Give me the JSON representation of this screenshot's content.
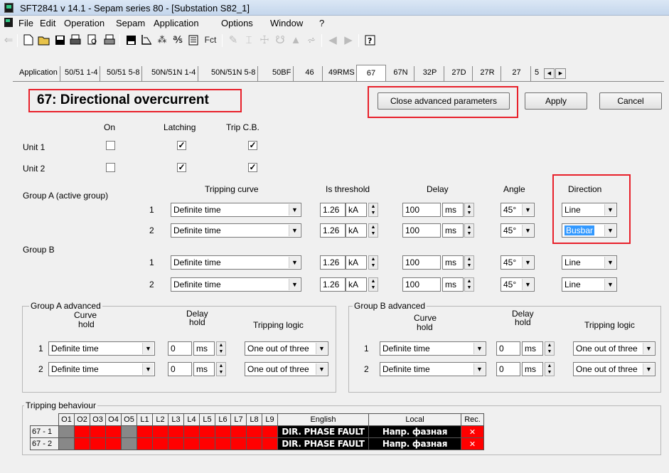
{
  "title_bar": {
    "title": "SFT2841  v 14.1 - Sepam series 80 - [Substation S82_1]"
  },
  "menu": [
    "File",
    "Edit",
    "Operation",
    "Sepam",
    "Application",
    "Options",
    "Window",
    "?"
  ],
  "toolbar": {
    "fct_label": "Fct",
    "icons": [
      "back-icon",
      "new-file-icon",
      "open-folder-icon",
      "save-icon",
      "print-icon",
      "print-preview-icon",
      "printer-setup-icon",
      "floppy-icon",
      "chart-icon",
      "connection-icon",
      "network-icon",
      "settings-icon",
      "fct-icon",
      "pen-icon",
      "tool-a-icon",
      "tool-b-icon",
      "tool-c-icon",
      "tool-d-icon",
      "tool-e-icon",
      "arrow-left-icon",
      "arrow-right-icon",
      "help-icon"
    ]
  },
  "tabs": [
    "Application",
    "50/51 1-4",
    "50/51 5-8",
    "50N/51N 1-4",
    "50N/51N 5-8",
    "50BF",
    "46",
    "49RMS",
    "67",
    "67N",
    "32P",
    "27D",
    "27R",
    "27"
  ],
  "tab_scroll": "5",
  "selected_tab": "67",
  "panel": {
    "heading": "67: Directional overcurrent",
    "close_adv_button": "Close advanced parameters",
    "apply_button": "Apply",
    "cancel_button": "Cancel",
    "col_on": "On",
    "col_latching": "Latching",
    "col_trip": "Trip C.B.",
    "unit1": {
      "label": "Unit 1",
      "on": false,
      "latching": true,
      "trip": true
    },
    "unit2": {
      "label": "Unit 2",
      "on": false,
      "latching": true,
      "trip": true
    },
    "headers": {
      "curve": "Tripping curve",
      "threshold": "Is threshold",
      "delay": "Delay",
      "angle": "Angle",
      "direction": "Direction"
    },
    "group_a_label": "Group A  (active group)",
    "group_b_label": "Group B",
    "rows": [
      {
        "n": "1",
        "curve": "Definite time",
        "is": "1.26",
        "is_unit": "kA",
        "delay": "100",
        "delay_unit": "ms",
        "angle": "45°",
        "direction": "Line"
      },
      {
        "n": "2",
        "curve": "Definite time",
        "is": "1.26",
        "is_unit": "kA",
        "delay": "100",
        "delay_unit": "ms",
        "angle": "45°",
        "direction": "Busbar"
      },
      {
        "n": "1",
        "curve": "Definite time",
        "is": "1.26",
        "is_unit": "kA",
        "delay": "100",
        "delay_unit": "ms",
        "angle": "45°",
        "direction": "Line"
      },
      {
        "n": "2",
        "curve": "Definite time",
        "is": "1.26",
        "is_unit": "kA",
        "delay": "100",
        "delay_unit": "ms",
        "angle": "45°",
        "direction": "Line"
      }
    ],
    "adv_a": {
      "title": "Group A advanced",
      "h_curve_hold_1": "Curve",
      "h_curve_hold_2": "hold",
      "h_delay_hold_1": "Delay",
      "h_delay_hold_2": "hold",
      "h_logic": "Tripping logic",
      "rows": [
        {
          "n": "1",
          "curve": "Definite time",
          "delay": "0",
          "unit": "ms",
          "logic": "One out of three"
        },
        {
          "n": "2",
          "curve": "Definite time",
          "delay": "0",
          "unit": "ms",
          "logic": "One out of three"
        }
      ]
    },
    "adv_b": {
      "title": "Group B advanced",
      "h_curve_hold_1": "Curve",
      "h_curve_hold_2": "hold",
      "h_delay_hold_1": "Delay",
      "h_delay_hold_2": "hold",
      "h_logic": "Tripping logic",
      "rows": [
        {
          "n": "1",
          "curve": "Definite time",
          "delay": "0",
          "unit": "ms",
          "logic": "One out of three"
        },
        {
          "n": "2",
          "curve": "Definite time",
          "delay": "0",
          "unit": "ms",
          "logic": "One out of three"
        }
      ]
    },
    "tripping": {
      "title": "Tripping behaviour",
      "columns": [
        "O1",
        "O2",
        "O3",
        "O4",
        "O5",
        "L1",
        "L2",
        "L3",
        "L4",
        "L5",
        "L6",
        "L7",
        "L8",
        "L9"
      ],
      "english_header": "English",
      "local_header": "Local",
      "rec_header": "Rec.",
      "rows": [
        {
          "label": "67 - 1",
          "english": "DIR. PHASE FAULT",
          "local": "Напр. фазная",
          "rec": "✕"
        },
        {
          "label": "67 - 2",
          "english": "DIR. PHASE FAULT",
          "local": "Напр. фазная",
          "rec": "✕"
        }
      ]
    }
  },
  "colors": {
    "highlight_red": "#e8202a",
    "cell_red": "#ff0000",
    "cell_gray": "#888888",
    "selection_blue": "#3399ff"
  }
}
